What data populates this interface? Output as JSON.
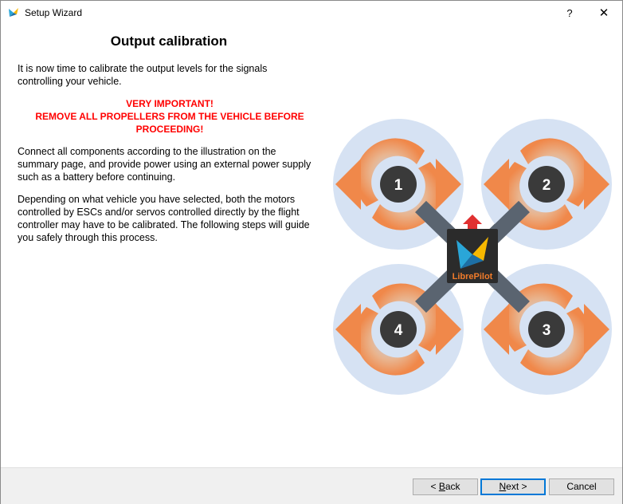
{
  "window": {
    "title": "Setup Wizard",
    "help_label": "?",
    "close_label": "✕"
  },
  "page": {
    "title": "Output calibration",
    "intro": "It is now time to calibrate the output levels for the signals controlling your vehicle.",
    "warning_line1": "VERY IMPORTANT!",
    "warning_line2": "REMOVE ALL PROPELLERS FROM THE VEHICLE BEFORE PROCEEDING!",
    "connect": "Connect all components according to the illustration on the summary page, and provide power using an external power supply such as a battery before continuing.",
    "depending": "Depending on what vehicle you have selected, both the motors controlled by ESCs and/or servos controlled directly by the flight controller may have to be calibrated. The following steps will guide you safely through this process."
  },
  "illustration": {
    "motors": [
      {
        "label": "1"
      },
      {
        "label": "2"
      },
      {
        "label": "3"
      },
      {
        "label": "4"
      }
    ],
    "logo_text": "LibrePilot"
  },
  "buttons": {
    "back_mnemonic": "B",
    "back_rest": "ack",
    "back_prefix": "< ",
    "next_mnemonic": "N",
    "next_rest": "ext >",
    "cancel": "Cancel"
  },
  "colors": {
    "warning": "#ff0000",
    "accent": "#0078d7",
    "prop_halo": "#d6e2f3",
    "arrow": "#f0884a",
    "motor": "#3a3a3a",
    "arm": "#5a6470",
    "logo_orange": "#f07b2a"
  }
}
